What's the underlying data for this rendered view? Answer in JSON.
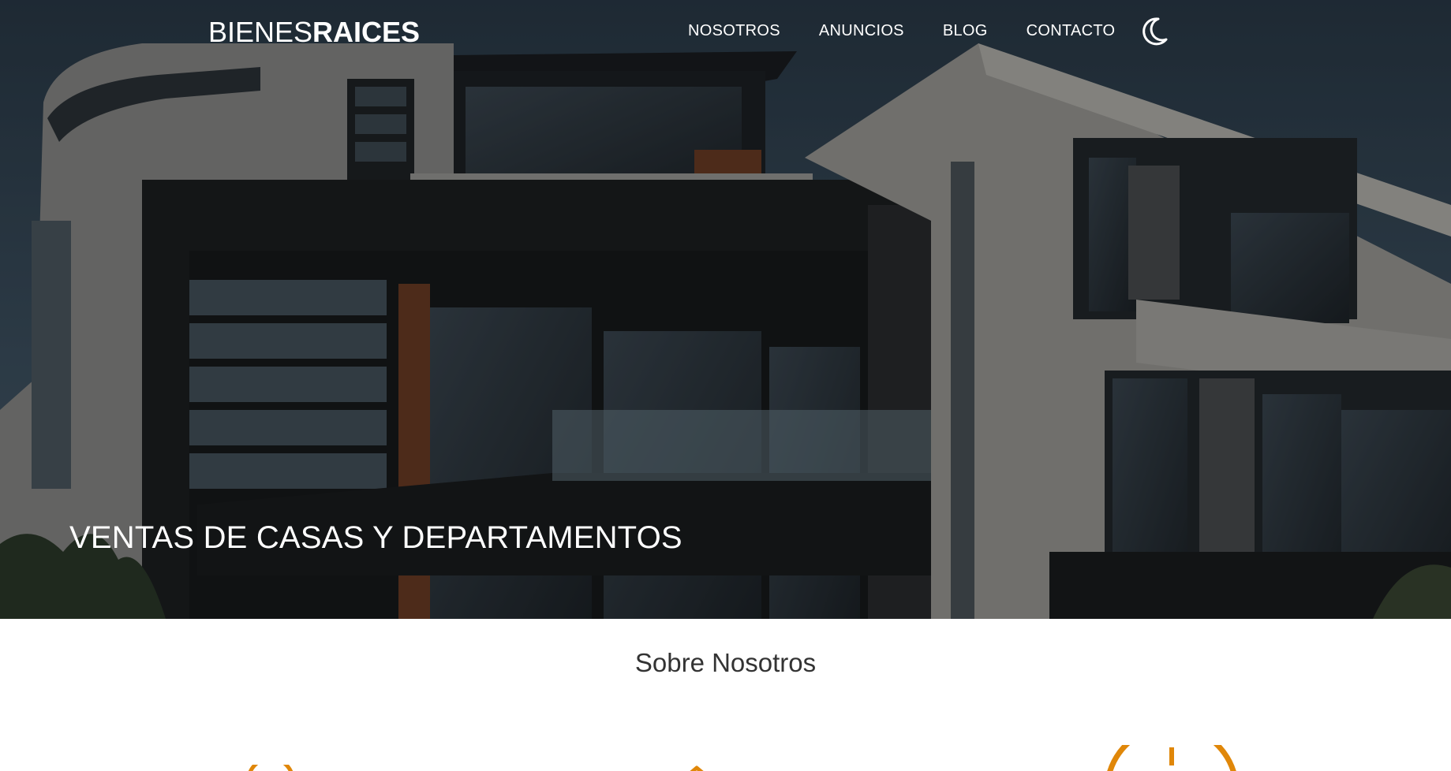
{
  "header": {
    "logo_light": "BIENES",
    "logo_bold": "RAICES",
    "nav": [
      {
        "label": "NOSOTROS"
      },
      {
        "label": "ANUNCIOS"
      },
      {
        "label": "BLOG"
      },
      {
        "label": "CONTACTO"
      }
    ],
    "theme_toggle_icon": "moon-icon"
  },
  "hero": {
    "title": "VENTAS DE CASAS Y DEPARTAMENTOS",
    "image": "modern-house-photo"
  },
  "about": {
    "title": "Sobre Nosotros",
    "icons": [
      "security-icon",
      "price-icon",
      "time-icon"
    ]
  },
  "colors": {
    "accent": "#e08709",
    "text_dark": "#333333",
    "text_light": "#ffffff"
  }
}
